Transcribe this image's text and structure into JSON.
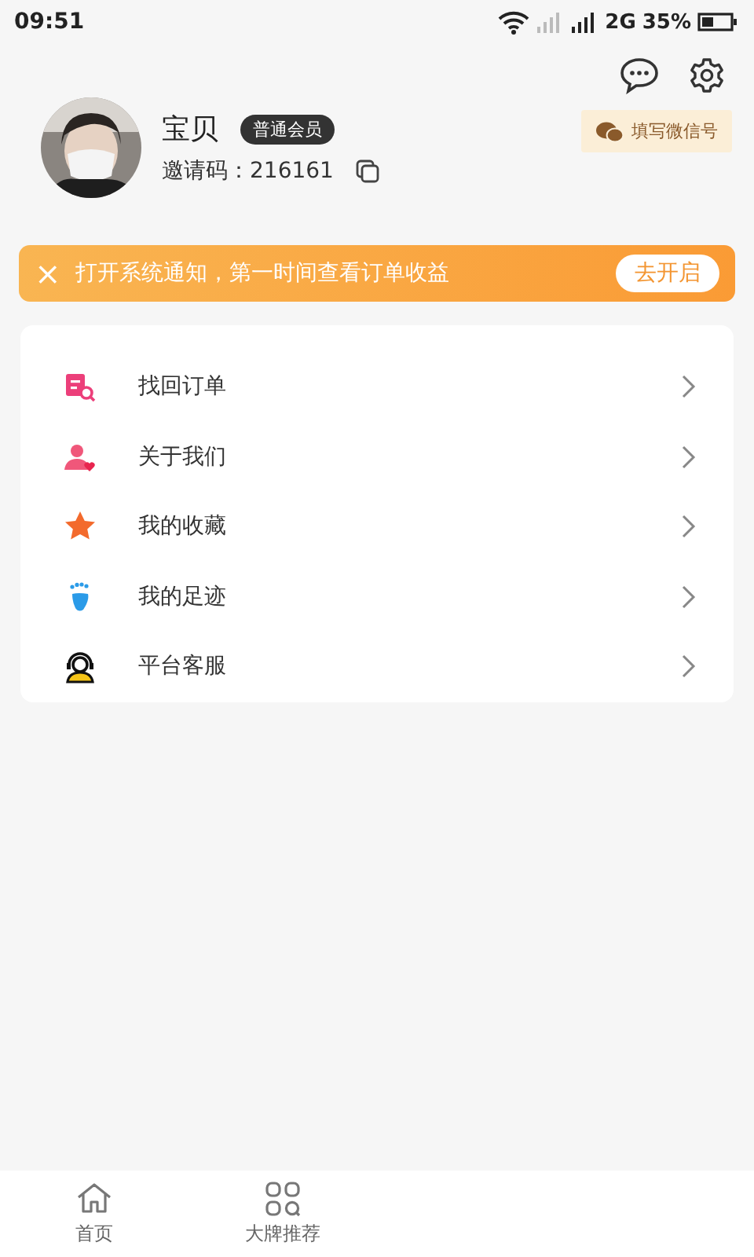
{
  "status_bar": {
    "time": "09:51",
    "network": "2G",
    "battery": "35%"
  },
  "profile": {
    "name": "宝贝",
    "badge": "普通会员",
    "invite_label": "邀请码：",
    "invite_code": "216161",
    "wechat_button": "填写微信号"
  },
  "notice": {
    "close": "×",
    "text": "打开系统通知，第一时间查看订单收益",
    "button": "去开启"
  },
  "menu": [
    {
      "kind": "order",
      "label": "找回订单"
    },
    {
      "kind": "about",
      "label": "关于我们"
    },
    {
      "kind": "favorite",
      "label": "我的收藏"
    },
    {
      "kind": "footprint",
      "label": "我的足迹"
    },
    {
      "kind": "service",
      "label": "平台客服"
    }
  ],
  "tab_bar": [
    {
      "kind": "home",
      "label": "首页",
      "selected": false
    },
    {
      "kind": "brands",
      "label": "大牌推荐",
      "selected": false
    }
  ]
}
